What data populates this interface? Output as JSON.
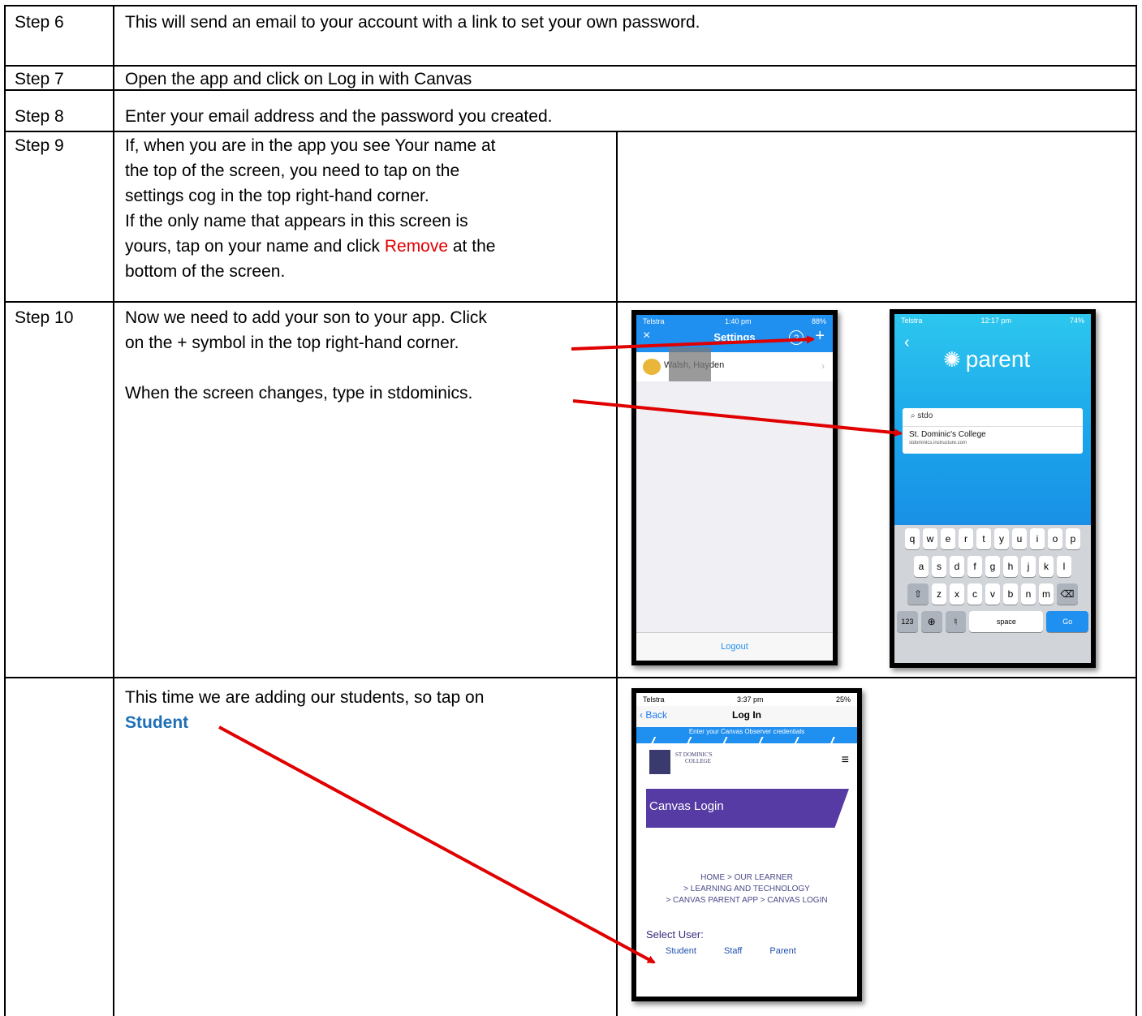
{
  "rows": [
    {
      "label": "Step 6",
      "text": "This will send an email to your account with a link to set your own password."
    },
    {
      "label": "Step 7",
      "text": "Open the app and click on Log in with Canvas"
    },
    {
      "label": "Step 8",
      "text": "Enter your email address and the password you created."
    },
    {
      "label": "Step 9",
      "lines": [
        "If, when you are in the app you see Your name at",
        "the top of the screen, you need to tap on the",
        "settings cog in the top right-hand corner.",
        "If the only name that appears in this screen is"
      ],
      "line5_pre": "yours, tap on your name and click ",
      "line5_red": "Remove",
      "line5_post": " at the",
      "line6": "bottom of the screen."
    },
    {
      "label": "Step 10",
      "lines": [
        "Now we need to add your son to your app. Click",
        "on the + symbol in the top right-hand corner."
      ],
      "line3": "When the screen changes, type in stdominics."
    },
    {
      "label": "",
      "line1": "This time we are adding our students, so tap on",
      "line2": "Student"
    }
  ],
  "phone_settings": {
    "carrier": "Telstra",
    "time": "1:40 pm",
    "battery": "88%",
    "title": "Settings",
    "help": "?",
    "plus": "+",
    "close": "×",
    "name": "Walsh, Hayden",
    "logout": "Logout"
  },
  "phone_parent": {
    "carrier": "Telstra",
    "time": "12:17 pm",
    "battery": "74%",
    "logo": "parent",
    "search_value": "stdo",
    "college": "St. Dominic's College",
    "url": "stdominics.instructure.com",
    "keys_row1": [
      "q",
      "w",
      "e",
      "r",
      "t",
      "y",
      "u",
      "i",
      "o",
      "p"
    ],
    "keys_row2": [
      "a",
      "s",
      "d",
      "f",
      "g",
      "h",
      "j",
      "k",
      "l"
    ],
    "keys_row3": [
      "z",
      "x",
      "c",
      "v",
      "b",
      "n",
      "m"
    ],
    "key_123": "123",
    "key_space": "space",
    "key_go": "Go"
  },
  "phone_login": {
    "carrier": "Telstra",
    "time": "3:37 pm",
    "battery": "25%",
    "back": "Back",
    "title": "Log In",
    "banner": "Enter your Canvas Observer credentials",
    "school": "ST DOMINIC'S",
    "school_sub": "COLLEGE",
    "heading": "Canvas Login",
    "crumb1": "HOME > OUR LEARNER",
    "crumb2": "> LEARNING AND TECHNOLOGY",
    "crumb3": "> CANVAS PARENT APP > CANVAS LOGIN",
    "select_label": "Select User:",
    "options": [
      "Student",
      "Staff",
      "Parent"
    ]
  },
  "colors": {
    "arrow": "#e00000",
    "remove": "#e00000",
    "student": "#1e6fb5"
  }
}
